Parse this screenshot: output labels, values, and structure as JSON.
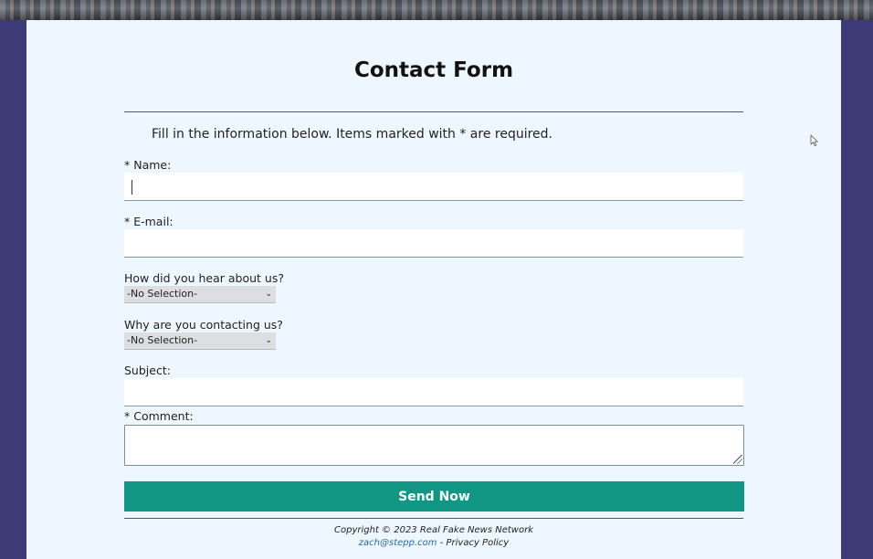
{
  "form": {
    "title": "Contact Form",
    "instructions": "Fill in the information below. Items marked with * are required.",
    "name_label": "* Name:",
    "name_value": "",
    "email_label": "* E-mail:",
    "email_value": "",
    "heard_label": "How did you hear about us?",
    "heard_selected": "-No Selection-",
    "reason_label": "Why are you contacting us?",
    "reason_selected": "-No Selection-",
    "subject_label": "Subject:",
    "subject_value": "",
    "comment_label": "* Comment:",
    "comment_value": "",
    "submit_label": "Send Now"
  },
  "footer": {
    "copyright": "Copyright © 2023 Real Fake News Network",
    "email_link": "zach@stepp.com",
    "separator": " - ",
    "privacy_link": "Privacy Policy"
  },
  "colors": {
    "page_background": "#3e3a78",
    "panel_background": "#eef6ff",
    "submit_button": "#119683",
    "link": "#2a6a9a"
  }
}
